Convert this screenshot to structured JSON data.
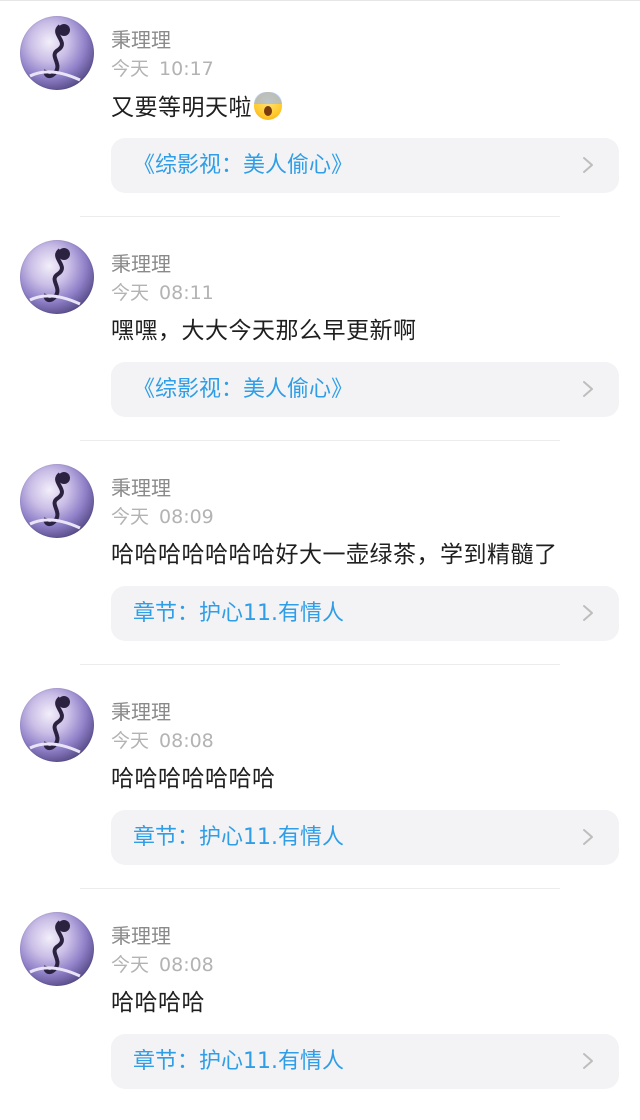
{
  "comments": [
    {
      "user": "秉理理",
      "date": "今天",
      "time": "10:17",
      "text": "又要等明天啦",
      "emoji": "screaming-face-emoji",
      "link": "《综影视：美人偷心》"
    },
    {
      "user": "秉理理",
      "date": "今天",
      "time": "08:11",
      "text": "嘿嘿，大大今天那么早更新啊",
      "link": "《综影视：美人偷心》"
    },
    {
      "user": "秉理理",
      "date": "今天",
      "time": "08:09",
      "text": "哈哈哈哈哈哈哈好大一壶绿茶，学到精髓了",
      "link": "章节：护心11.有情人"
    },
    {
      "user": "秉理理",
      "date": "今天",
      "time": "08:08",
      "text": "哈哈哈哈哈哈哈",
      "link": "章节：护心11.有情人"
    },
    {
      "user": "秉理理",
      "date": "今天",
      "time": "08:08",
      "text": "哈哈哈哈",
      "link": "章节：护心11.有情人"
    }
  ],
  "colors": {
    "link": "#2f9ee6",
    "card_bg": "#f3f3f5",
    "username": "#8a8a8a",
    "timestamp": "#b3b3b3"
  }
}
